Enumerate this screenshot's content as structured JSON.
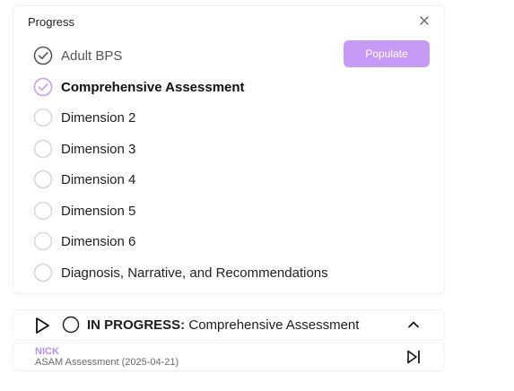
{
  "panel": {
    "title": "Progress",
    "populate_label": "Populate",
    "steps": [
      {
        "label": "Adult BPS",
        "state": "done"
      },
      {
        "label": "Comprehensive Assessment",
        "state": "current"
      },
      {
        "label": "Dimension 2",
        "state": "pending"
      },
      {
        "label": "Dimension 3",
        "state": "pending"
      },
      {
        "label": "Dimension 4",
        "state": "pending"
      },
      {
        "label": "Dimension 5",
        "state": "pending"
      },
      {
        "label": "Dimension 6",
        "state": "pending"
      },
      {
        "label": "Diagnosis, Narrative, and Recommendations",
        "state": "pending"
      }
    ]
  },
  "status_bar": {
    "status_key": "IN PROGRESS:",
    "status_value": "Comprehensive Assessment"
  },
  "footer": {
    "user": "NICK",
    "assessment": "ASAM Assessment (2025-04-21)"
  },
  "colors": {
    "accent": "#c69af4",
    "accent_text": "#b98ee8",
    "done_check": "#555555",
    "pending_ring": "#d6d6d6"
  },
  "icons": {
    "close": "close-icon",
    "done": "check-circle-icon",
    "current": "check-circle-accent-icon",
    "pending": "empty-circle-icon",
    "play": "play-icon",
    "collapse": "chevron-up-icon",
    "skip": "skip-next-icon"
  }
}
